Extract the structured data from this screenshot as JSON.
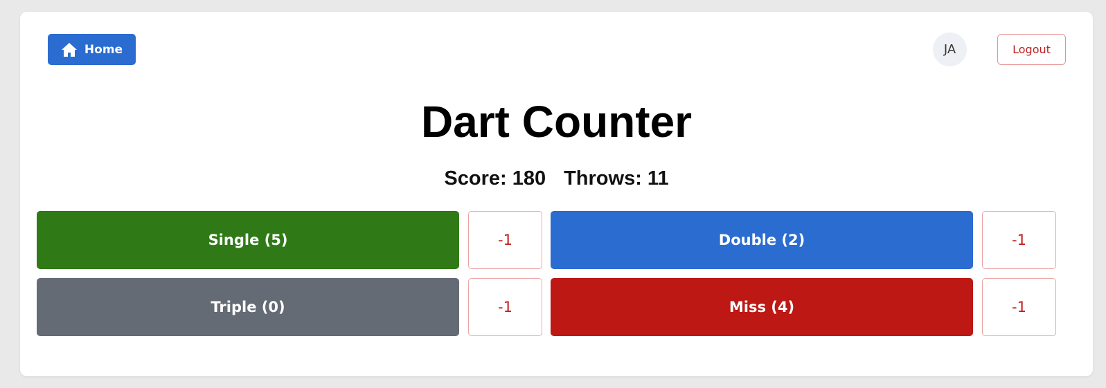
{
  "header": {
    "home_label": "Home",
    "home_icon": "home-icon",
    "avatar_initials": "JA",
    "logout_label": "Logout"
  },
  "title": "Dart Counter",
  "stats": {
    "score": "Score: 180",
    "throws": "Throws: 11"
  },
  "counters": {
    "single": {
      "label": "Single (5)",
      "minus": "-1",
      "color": "#2f7a17"
    },
    "double": {
      "label": "Double (2)",
      "minus": "-1",
      "color": "#2b6cd0"
    },
    "triple": {
      "label": "Triple (0)",
      "minus": "-1",
      "color": "#656b74"
    },
    "miss": {
      "label": "Miss (4)",
      "minus": "-1",
      "color": "#bd1814"
    }
  },
  "colors": {
    "primary": "#2b6cd0",
    "danger": "#c01e1e",
    "background": "#e9e9e9",
    "card": "#ffffff"
  }
}
